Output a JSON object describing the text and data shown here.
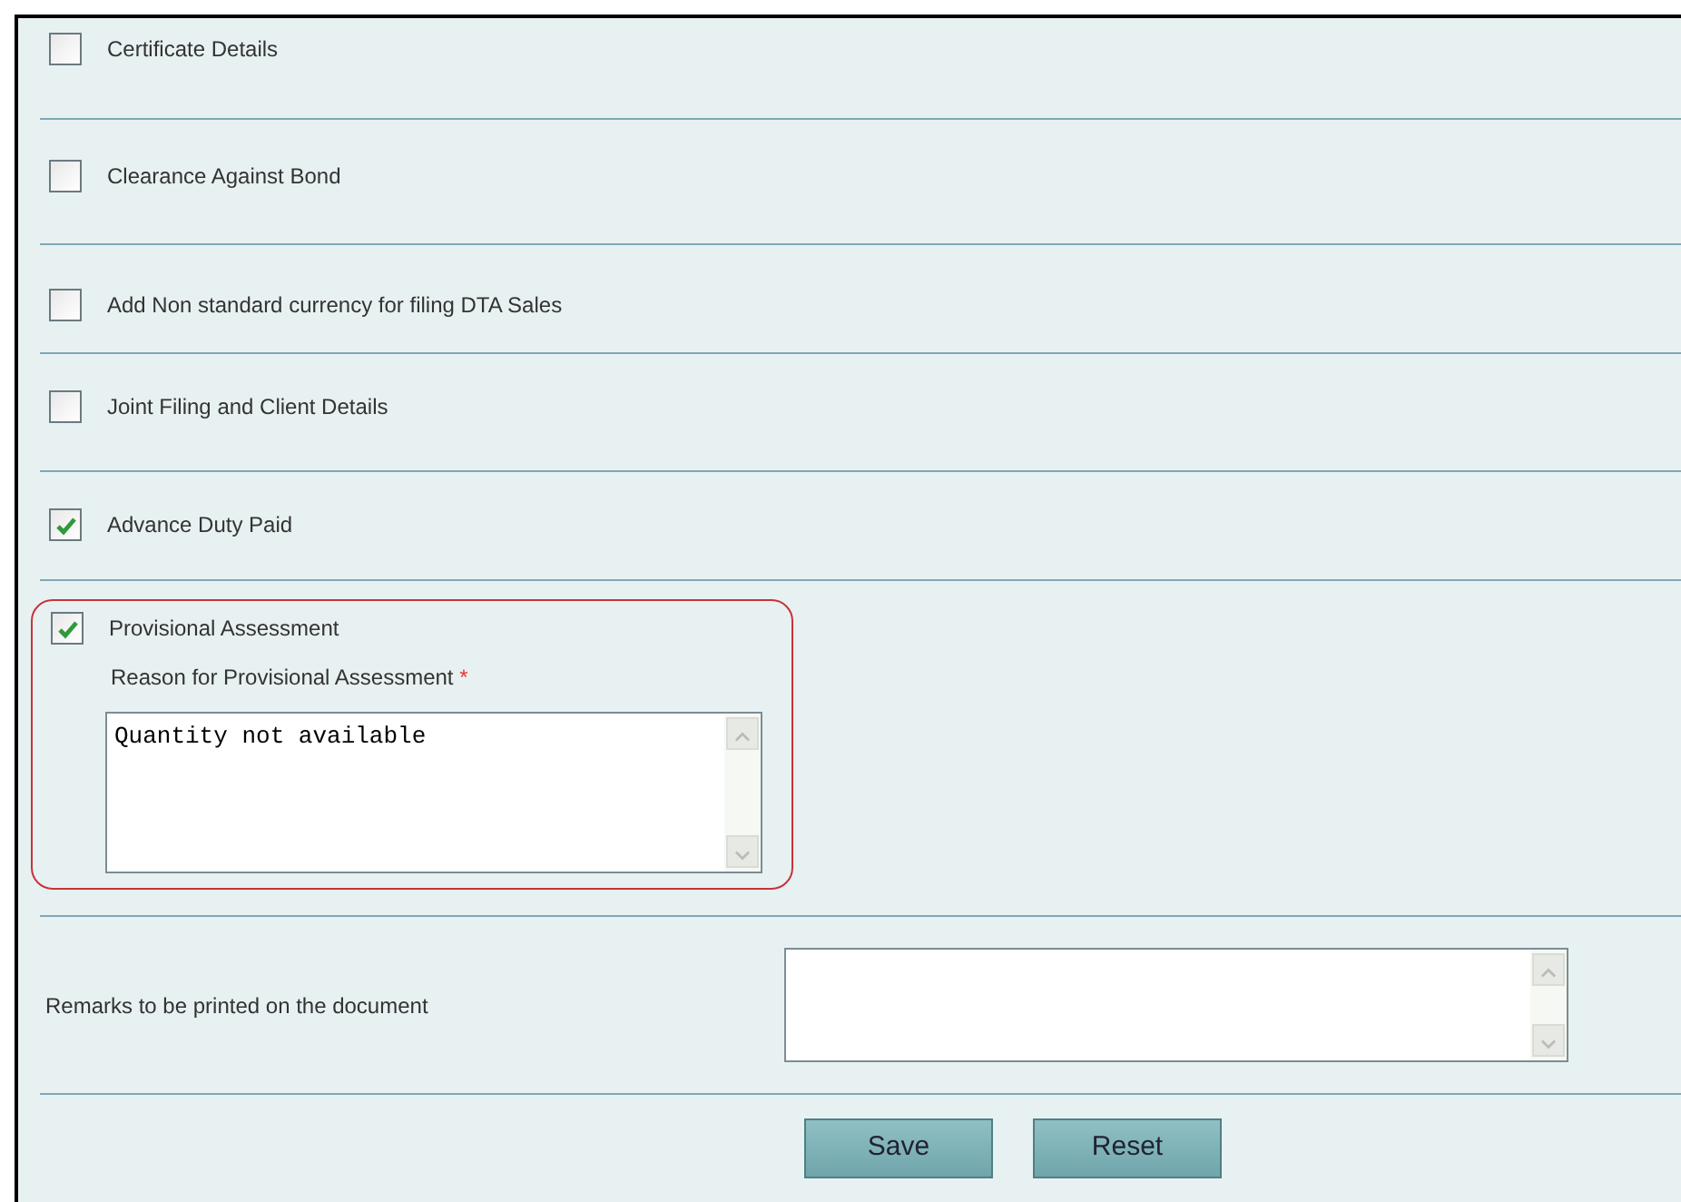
{
  "options": [
    {
      "label": "Certificate Details",
      "checked": false
    },
    {
      "label": "Clearance Against Bond",
      "checked": false
    },
    {
      "label": "Add Non standard currency for filing DTA Sales",
      "checked": false
    },
    {
      "label": "Joint Filing and Client Details",
      "checked": false
    },
    {
      "label": "Advance Duty Paid",
      "checked": true
    }
  ],
  "provisional": {
    "label": "Provisional Assessment",
    "checked": true,
    "highlighted": true,
    "reason_label": "Reason for Provisional Assessment",
    "required_mark": "*",
    "reason_value": "Quantity not available"
  },
  "remarks": {
    "label": "Remarks to be printed on the document"
  },
  "buttons": [
    "Save",
    "Reset"
  ]
}
